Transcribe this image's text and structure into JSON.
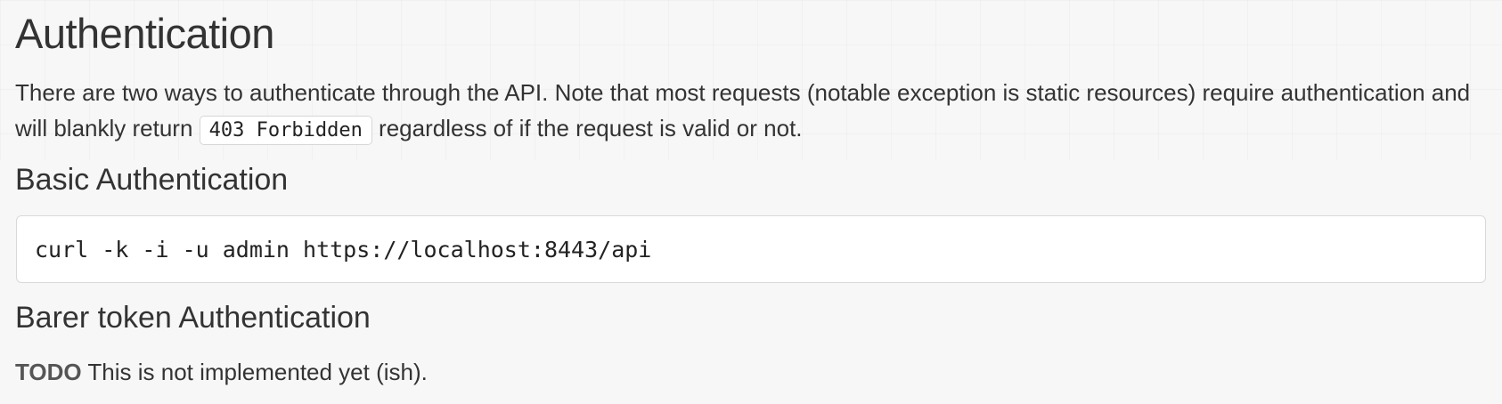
{
  "section": {
    "title": "Authentication",
    "intro": {
      "text_before": "There are two ways to authenticate through the API. Note that most requests (notable exception is static resources) require authentication and will blankly return ",
      "code": "403 Forbidden",
      "text_after": " regardless of if the request is valid or not."
    }
  },
  "basic_auth": {
    "heading": "Basic Authentication",
    "command": "curl -k -i -u admin https://localhost:8443/api"
  },
  "token_auth": {
    "heading": "Barer token Authentication",
    "todo_label": "TODO",
    "todo_text": " This is not implemented yet (ish)."
  }
}
